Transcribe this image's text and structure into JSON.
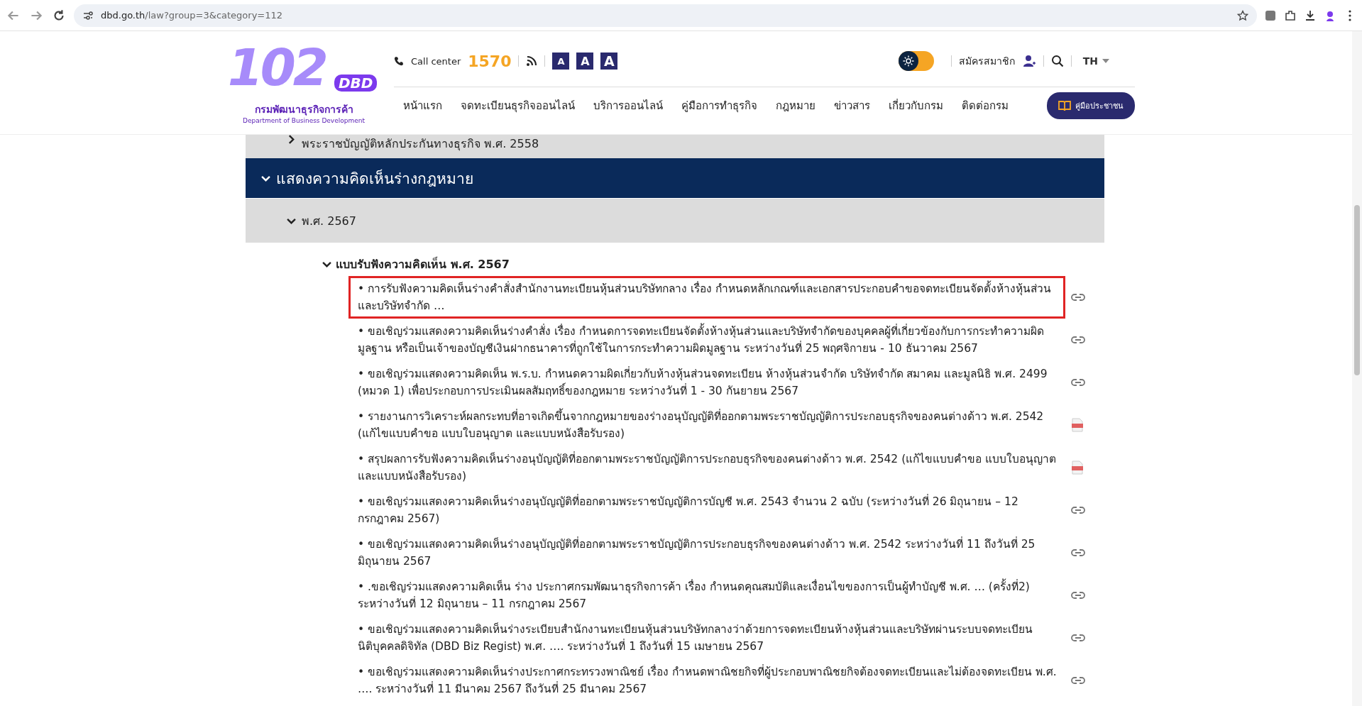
{
  "browser": {
    "url_host": "dbd.go.th",
    "url_path": "/law?group=3&category=112"
  },
  "header": {
    "logo_mark": "102",
    "logo_badge": "DBD",
    "org_name": "กรมพัฒนาธุรกิจการค้า",
    "org_name_en": "Department of Business Development",
    "call_center_label": "Call center",
    "call_center_number": "1570",
    "font_sizes": [
      "A",
      "A",
      "A"
    ],
    "theme_toggle": {
      "on": true
    },
    "register": "สมัครสมาชิก",
    "language": "TH"
  },
  "nav": {
    "items": [
      "หน้าแรก",
      "จดทะเบียนธุรกิจออนไลน์",
      "บริการออนไลน์",
      "คู่มือการทำธุรกิจ",
      "กฎหมาย",
      "ข่าวสาร",
      "เกี่ยวกับกรม",
      "ติดต่อกรม"
    ],
    "guide_button": "คู่มือประชาชน"
  },
  "sections": [
    {
      "title": "พระราชบัญญัติหลักประกันทางธุรกิจ พ.ศ. 2558",
      "kind": "sub",
      "expanded": false
    },
    {
      "title": "แสดงความคิดเห็นร่างกฎหมาย",
      "kind": "main",
      "expanded": true
    },
    {
      "title": "พ.ศ. 2567",
      "kind": "sub",
      "expanded": true
    }
  ],
  "group": {
    "title": "แบบรับฟังความคิดเห็น พ.ศ. 2567",
    "expanded": true
  },
  "items": [
    {
      "text": "• การรับฟังความคิดเห็นร่างคำสั่งสำนักงานทะเบียนหุ้นส่วนบริษัทกลาง เรื่อง กำหนดหลักเกณฑ์และเอกสารประกอบคำขอจดทะเบียนจัดตั้งห้างหุ้นส่วนและบริษัทจำกัด …",
      "kind": "link",
      "highlighted": true
    },
    {
      "text": "• ขอเชิญร่วมแสดงความคิดเห็นร่างคำสั่ง เรื่อง กำหนดการจดทะเบียนจัดตั้งห้างหุ้นส่วนและบริษัทจำกัดของบุคคลผู้ที่เกี่ยวข้องกับการกระทำความผิดมูลฐาน หรือเป็นเจ้าของบัญชีเงินฝากธนาคารที่ถูกใช้ในการกระทำความผิดมูลฐาน ระหว่างวันที่ 25 พฤศจิกายน - 10 ธันวาคม 2567",
      "kind": "link",
      "highlighted": false
    },
    {
      "text": "• ขอเชิญร่วมแสดงความคิดเห็น พ.ร.บ. กำหนดความผิดเกี่ยวกับห้างหุ้นส่วนจดทะเบียน ห้างหุ้นส่วนจำกัด บริษัทจำกัด สมาคม และมูลนิธิ พ.ศ. 2499 (หมวด 1) เพื่อประกอบการประเมินผลสัมฤทธิ์ของกฎหมาย ระหว่างวันที่ 1 - 30 กันยายน 2567",
      "kind": "link",
      "highlighted": false
    },
    {
      "text": "• รายงานการวิเคราะห์ผลกระทบที่อาจเกิดขึ้นจากกฎหมายของร่างอนุบัญญัติที่ออกตามพระราชบัญญัติการประกอบธุรกิจของคนต่างด้าว พ.ศ. 2542 (แก้ไขแบบคำขอ แบบใบอนุญาต และแบบหนังสือรับรอง)",
      "kind": "pdf",
      "highlighted": false
    },
    {
      "text": "• สรุปผลการรับฟังความคิดเห็นร่างอนุบัญญัติที่ออกตามพระราชบัญญัติการประกอบธุรกิจของคนต่างด้าว พ.ศ. 2542 (แก้ไขแบบคำขอ แบบใบอนุญาต และแบบหนังสือรับรอง)",
      "kind": "pdf",
      "highlighted": false
    },
    {
      "text": "• ขอเชิญร่วมแสดงความคิดเห็นร่างอนุบัญญัติที่ออกตามพระราชบัญญัติการบัญชี พ.ศ. 2543 จำนวน 2 ฉบับ (ระหว่างวันที่ 26 มิถุนายน – 12 กรกฎาคม 2567)",
      "kind": "link",
      "highlighted": false
    },
    {
      "text": "• ขอเชิญร่วมแสดงความคิดเห็นร่างอนุบัญญัติที่ออกตามพระราชบัญญัติการประกอบธุรกิจของคนต่างด้าว พ.ศ. 2542 ระหว่างวันที่ 11 ถึงวันที่ 25 มิถุนายน 2567",
      "kind": "link",
      "highlighted": false
    },
    {
      "text": "• .ขอเชิญร่วมแสดงความคิดเห็น ร่าง ประกาศกรมพัฒนาธุรกิจการค้า เรื่อง กำหนดคุณสมบัติและเงื่อนไขของการเป็นผู้ทำบัญชี พ.ศ. … (ครั้งที่2) ระหว่างวันที่ 12 มิถุนายน – 11 กรกฎาคม 2567",
      "kind": "link",
      "highlighted": false
    },
    {
      "text": "• ขอเชิญร่วมแสดงความคิดเห็นร่างระเบียบสำนักงานทะเบียนหุ้นส่วนบริษัทกลางว่าด้วยการจดทะเบียนห้างหุ้นส่วนและบริษัทผ่านระบบจดทะเบียนนิติบุคคลดิจิทัล (DBD Biz Regist) พ.ศ. …. ระหว่างวันที่ 1 ถึงวันที่ 15 เมษายน 2567",
      "kind": "link",
      "highlighted": false
    },
    {
      "text": "• ขอเชิญร่วมแสดงความคิดเห็นร่างประกาศกระทรวงพาณิชย์ เรื่อง กำหนดพาณิชยกิจที่ผู้ประกอบพาณิชยกิจต้องจดทะเบียนและไม่ต้องจดทะเบียน พ.ศ. …. ระหว่างวันที่ 11 มีนาคม 2567 ถึงวันที่ 25 มีนาคม 2567",
      "kind": "link",
      "highlighted": false
    }
  ]
}
